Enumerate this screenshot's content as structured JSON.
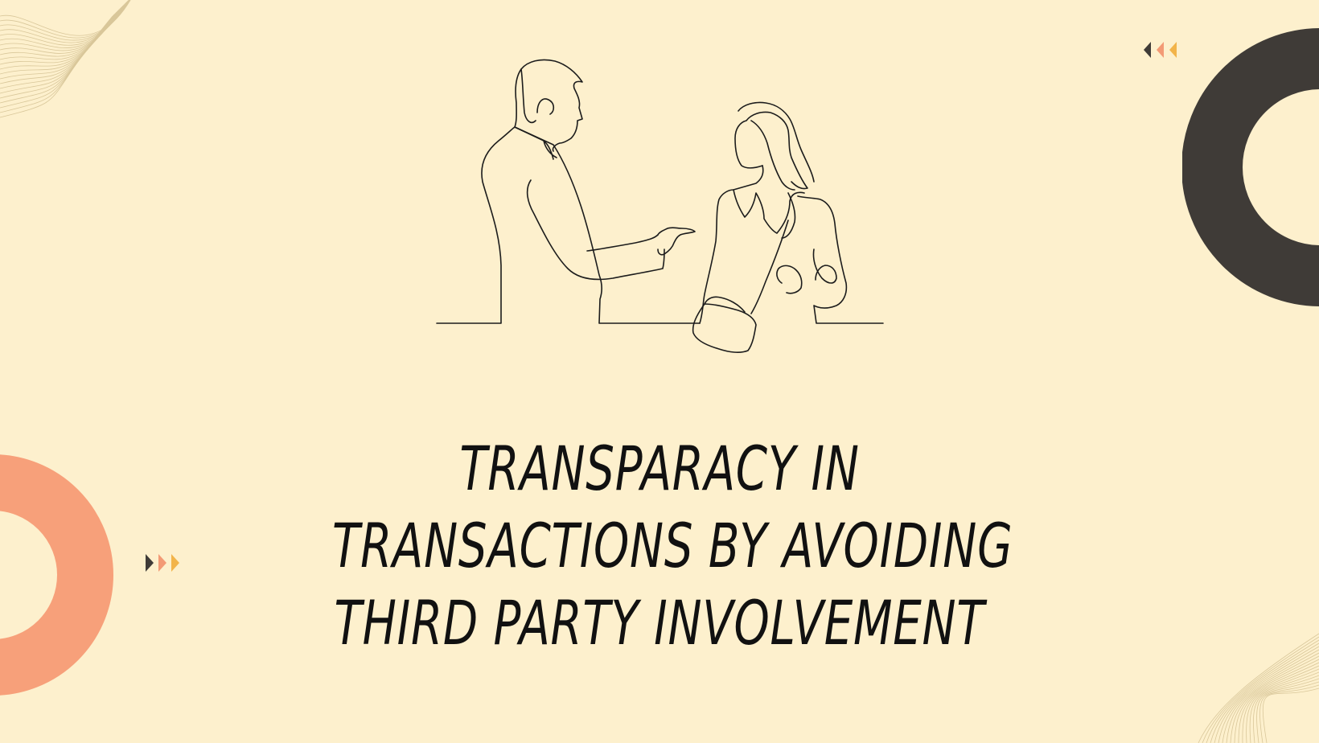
{
  "slide": {
    "headline_lines": [
      "TRANSPARACY IN",
      "TRANSACTIONS BY AVOIDING",
      "THIRD PARTY INVOLVEMENT"
    ]
  },
  "colors": {
    "background": "#fdf0cd",
    "text": "#111111",
    "dark_ring": "#3f3b37",
    "coral_ring": "#f7a07a",
    "arrow_dark": "#3f3b37",
    "arrow_coral": "#f39a75",
    "arrow_gold": "#f2b44a",
    "wave_lines": "#d9c79a",
    "line_art": "#1c1c1c"
  },
  "decorations": {
    "top_left": "wave-lines",
    "top_right_arrows": "triple-chevron-left-icon",
    "right_ring": "dark-ring",
    "left_ring": "coral-ring",
    "left_arrows": "triple-chevron-right-icon",
    "bottom_right": "wave-lines",
    "illustration": "two-people-talking-line-art"
  }
}
